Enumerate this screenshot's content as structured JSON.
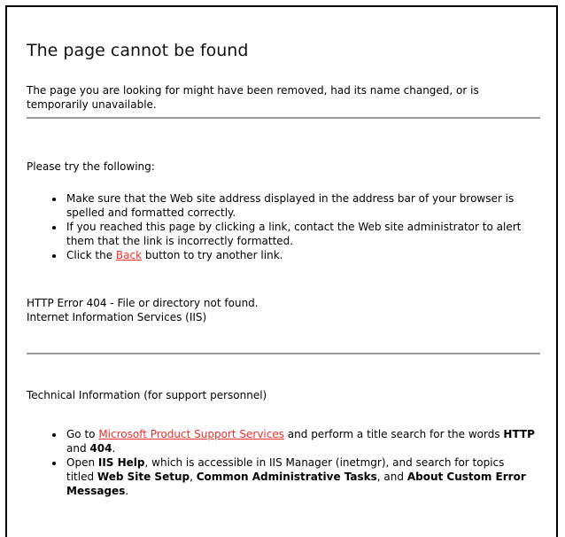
{
  "title": "The page cannot be found",
  "intro": "The page you are looking for might have been removed, had its name changed, or is temporarily unavailable.",
  "try_heading": "Please try the following:",
  "suggestions": {
    "item1": "Make sure that the Web site address displayed in the address bar of your browser is spelled and formatted correctly.",
    "item2": "If you reached this page by clicking a link, contact the Web site administrator to alert them that the link is incorrectly formatted.",
    "item3_before": "Click the ",
    "item3_link": "Back",
    "item3_after": " button to try another link."
  },
  "error": {
    "line1": "HTTP Error 404 - File or directory not found.",
    "line2": "Internet Information Services (IIS)"
  },
  "tech_heading": "Technical Information (for support personnel)",
  "tech_items": {
    "item1_before": "Go to ",
    "item1_link": "Microsoft Product Support Services",
    "item1_middle": " and perform a title search for the words ",
    "item1_bold1": "HTTP",
    "item1_and": " and ",
    "item1_bold2": "404",
    "item1_end": ".",
    "item2_before": "Open ",
    "item2_bold1": "IIS Help",
    "item2_middle": ", which is accessible in IIS Manager (inetmgr), and search for topics titled ",
    "item2_bold2": "Web Site Setup",
    "item2_comma": ", ",
    "item2_bold3": "Common Administrative Tasks",
    "item2_and": ", and ",
    "item2_bold4": "About Custom Error Messages",
    "item2_end": "."
  },
  "colors": {
    "link": "#e8312f",
    "rule": "#9a9a9a",
    "border": "#000000"
  }
}
